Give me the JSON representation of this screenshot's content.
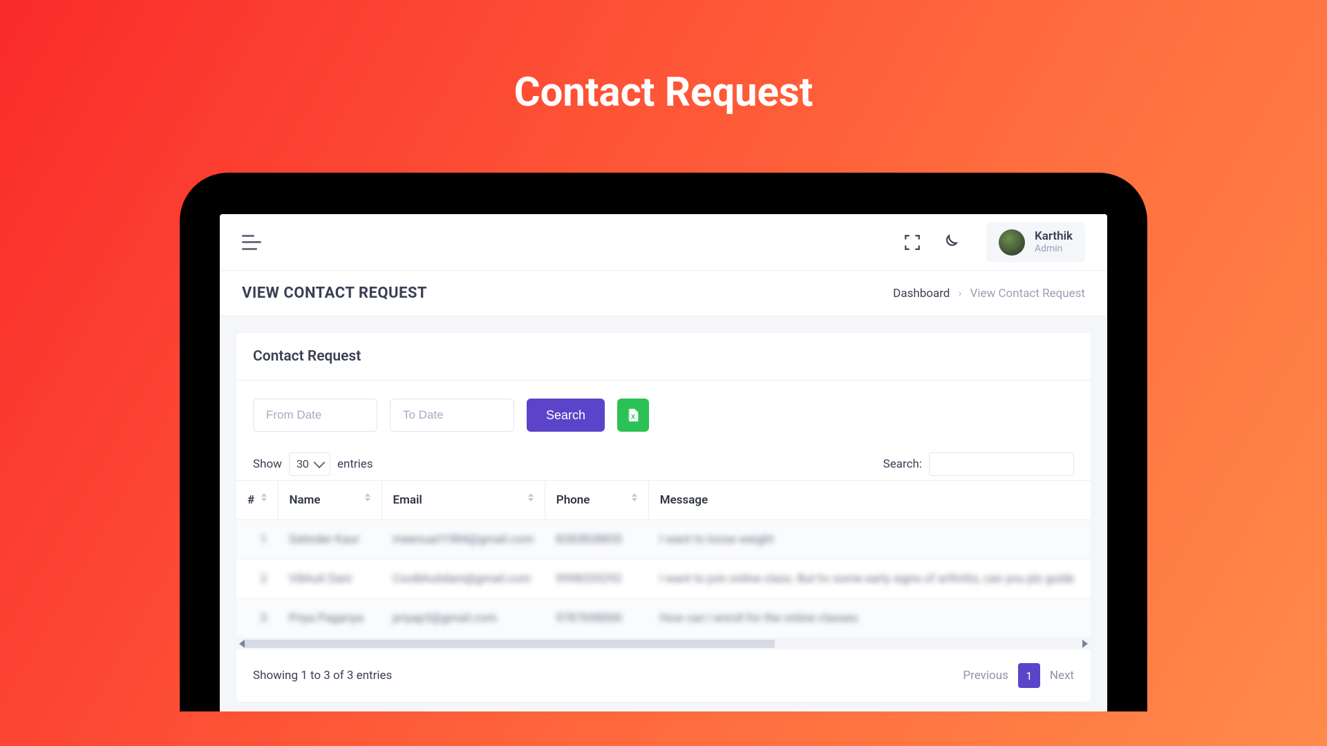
{
  "promo_title": "Contact Request",
  "topbar": {
    "user_name": "Karthik",
    "user_role": "Admin"
  },
  "page": {
    "title": "VIEW CONTACT REQUEST",
    "breadcrumb_root": "Dashboard",
    "breadcrumb_current": "View Contact Request"
  },
  "card": {
    "title": "Contact Request",
    "from_placeholder": "From Date",
    "to_placeholder": "To Date",
    "search_button": "Search"
  },
  "datatable": {
    "show_label_before": "Show",
    "show_label_after": "entries",
    "show_value": "30",
    "search_label": "Search:",
    "columns": {
      "idx": "#",
      "name": "Name",
      "email": "Email",
      "phone": "Phone",
      "message": "Message"
    },
    "rows": [
      {
        "idx": "1",
        "name": "Satinder Kaur",
        "email": "meenuarl1984@gmail.com",
        "phone": "8283828835",
        "message": "I want to loose weight"
      },
      {
        "idx": "2",
        "name": "Vibhuti Dani",
        "email": "Coolbhutidani@gmail.com",
        "phone": "9998335292",
        "message": "I want to join online class. But hv some early signs of arthritis, can you plz guide"
      },
      {
        "idx": "3",
        "name": "Priya Pagariya",
        "email": "priyap3@gmail.com",
        "phone": "9787698000",
        "message": "How can I enroll for the online classes"
      }
    ],
    "info": "Showing 1 to 3 of 3 entries",
    "prev": "Previous",
    "next": "Next",
    "current_page": "1"
  }
}
